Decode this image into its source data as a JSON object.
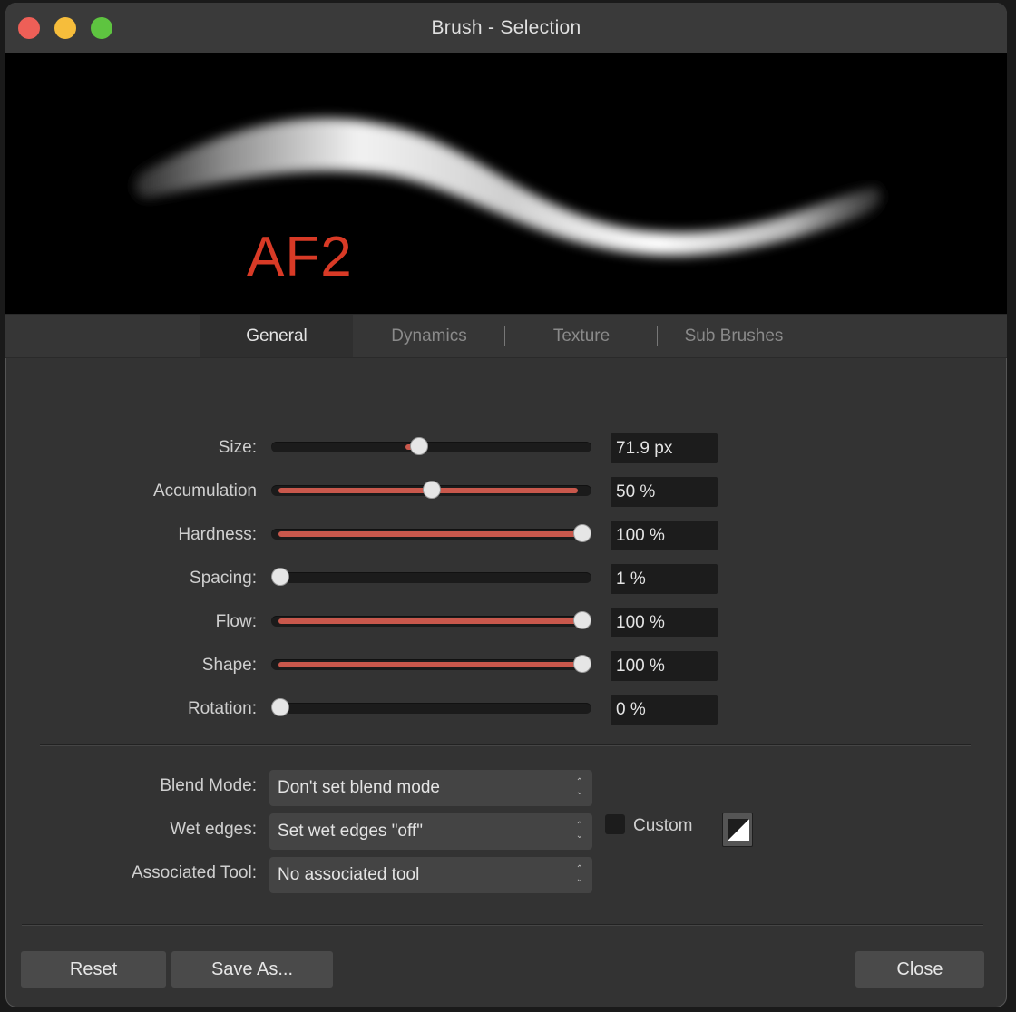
{
  "window": {
    "title": "Brush - Selection"
  },
  "preview": {
    "label": "AF2"
  },
  "tabs": [
    {
      "label": "General",
      "active": true
    },
    {
      "label": "Dynamics",
      "active": false
    },
    {
      "label": "Texture",
      "active": false
    },
    {
      "label": "Sub Brushes",
      "active": false
    }
  ],
  "sliders": [
    {
      "label": "Size:",
      "value": "71.9 px",
      "level": 0.46,
      "fill_from": 0.42,
      "fill_to": 0.46
    },
    {
      "label": "Accumulation",
      "value": "50 %",
      "level": 0.5,
      "fill_from": 0.0,
      "fill_to": 0.98
    },
    {
      "label": "Hardness:",
      "value": "100 %",
      "level": 1.0,
      "fill_from": 0.0,
      "fill_to": 1.0
    },
    {
      "label": "Spacing:",
      "value": "1 %",
      "level": 0.0,
      "fill_from": 0.0,
      "fill_to": 0.0
    },
    {
      "label": "Flow:",
      "value": "100 %",
      "level": 1.0,
      "fill_from": 0.0,
      "fill_to": 1.0
    },
    {
      "label": "Shape:",
      "value": "100 %",
      "level": 1.0,
      "fill_from": 0.0,
      "fill_to": 1.0
    },
    {
      "label": "Rotation:",
      "value": "0 %",
      "level": 0.0,
      "fill_from": 0.0,
      "fill_to": 0.0
    }
  ],
  "dropdowns": [
    {
      "label": "Blend Mode:",
      "value": "Don't set blend mode"
    },
    {
      "label": "Wet edges:",
      "value": "Set wet edges \"off\""
    },
    {
      "label": "Associated Tool:",
      "value": "No associated tool"
    }
  ],
  "custom": {
    "label": "Custom",
    "checked": false
  },
  "buttons": {
    "reset": "Reset",
    "save_as": "Save As...",
    "close": "Close"
  },
  "colors": {
    "accent": "#c9584c",
    "preview_label": "#d83a26",
    "close": "#ee5f57",
    "minimize": "#f6bd3b",
    "zoom": "#5ec440"
  }
}
